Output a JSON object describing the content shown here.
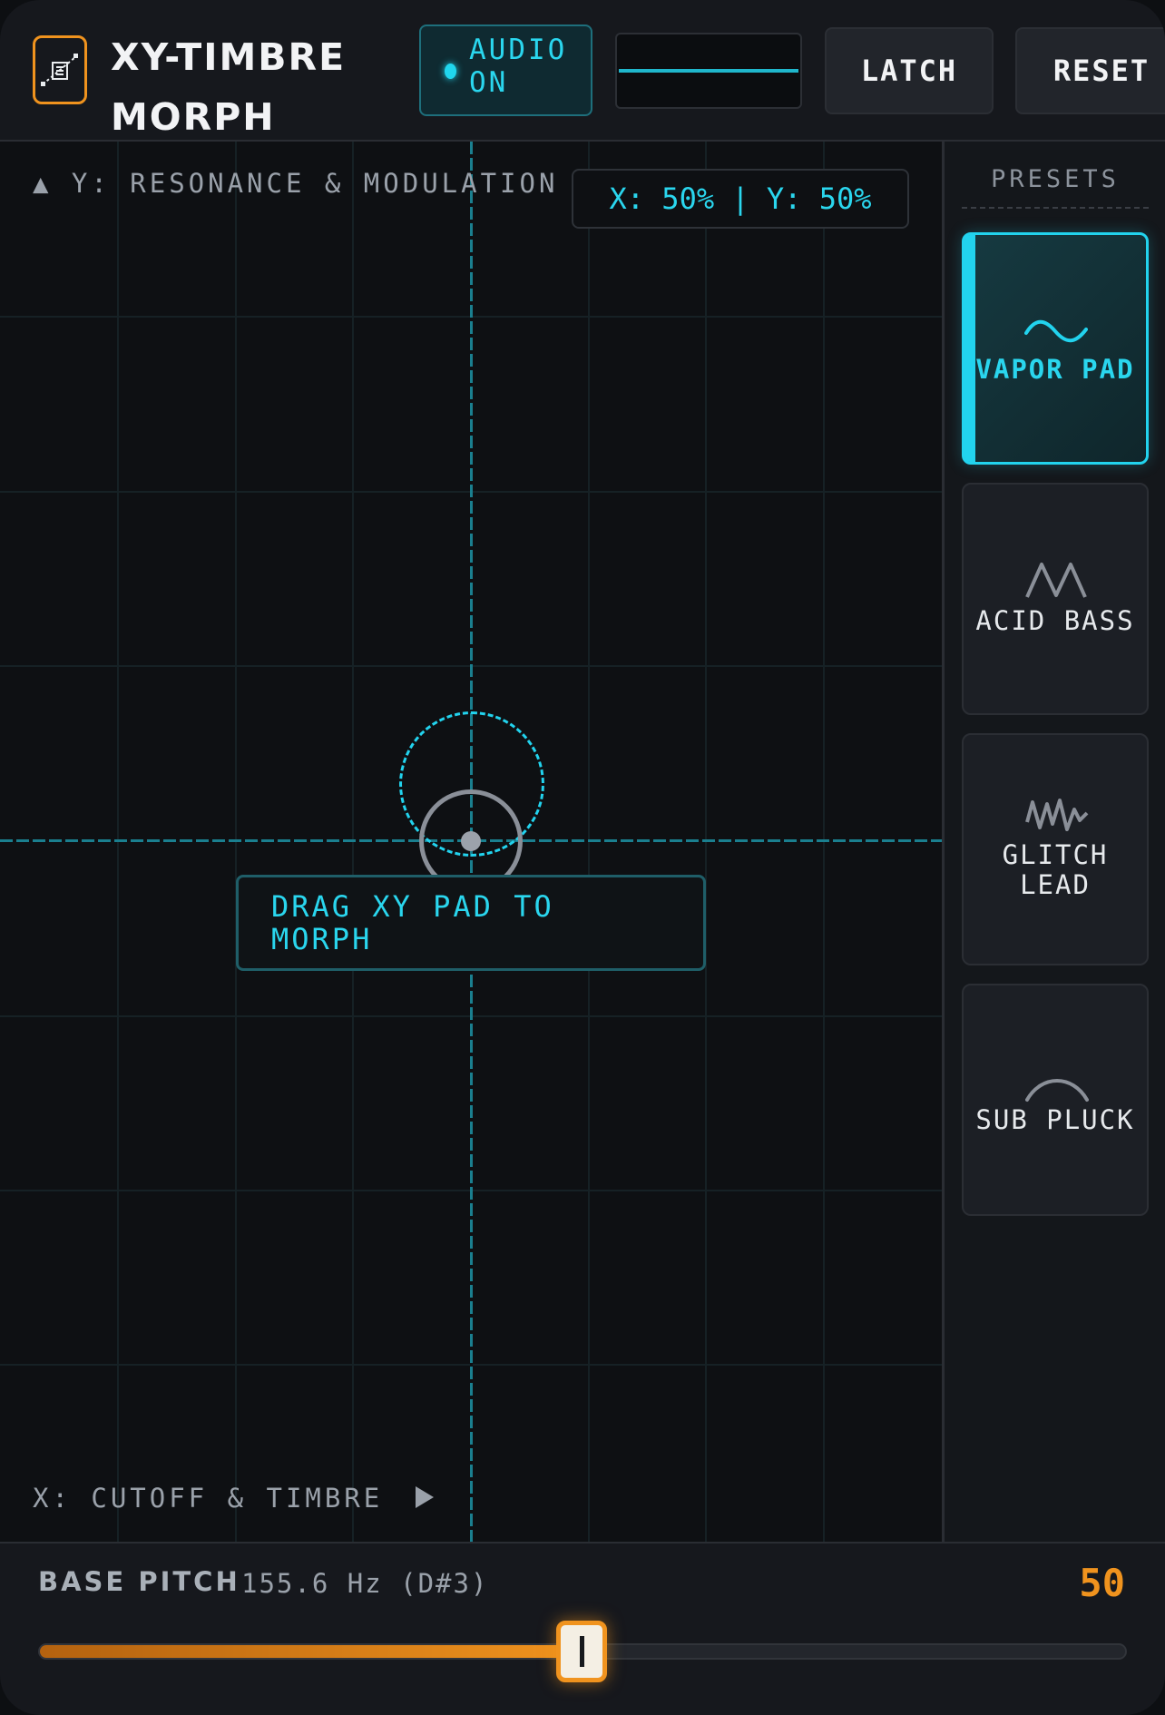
{
  "header": {
    "title": "XY-TIMBRE MORPH",
    "logo_icon": "xy-morph-icon",
    "audio_label": "AUDIO ON",
    "latch_label": "LATCH",
    "reset_label": "RESET"
  },
  "pad": {
    "y_axis_label": "▲ Y: RESONANCE & MODULATION",
    "x_axis_label": "X: CUTOFF & TIMBRE",
    "coords_readout": "X: 50% | Y: 50%",
    "hint": "DRAG XY PAD TO MORPH"
  },
  "presets": {
    "title": "PRESETS",
    "items": [
      {
        "label": "VAPOR PAD",
        "icon": "sine-wave-icon",
        "active": true
      },
      {
        "label": "ACID BASS",
        "icon": "zigzag-wave-icon",
        "active": false
      },
      {
        "label": "GLITCH LEAD",
        "icon": "noise-wave-icon",
        "active": false
      },
      {
        "label": "SUB PLUCK",
        "icon": "arc-wave-icon",
        "active": false
      }
    ]
  },
  "footer": {
    "pitch_title": "BASE PITCH",
    "pitch_value": "155.6 Hz (D#3)",
    "pitch_number": "50",
    "slider_fraction": 0.5
  },
  "colors": {
    "accent_cyan": "#22d3ee",
    "accent_orange": "#f0931e",
    "background": "#0f1115"
  }
}
